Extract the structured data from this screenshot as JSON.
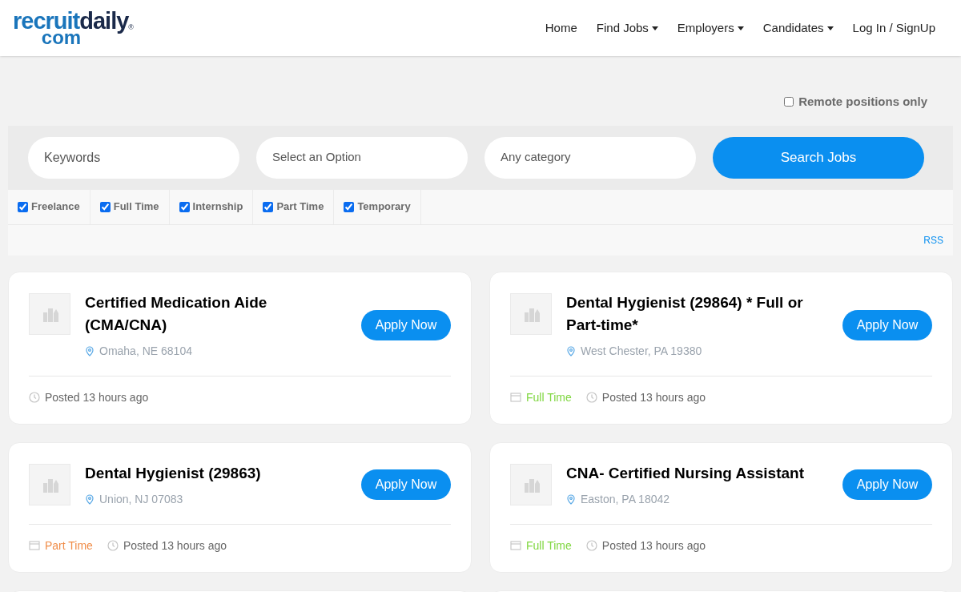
{
  "logo": {
    "part_1": "recruit",
    "part_2": "daily",
    "part_3": "com",
    "mark": "®"
  },
  "nav": [
    {
      "label": "Home",
      "dropdown": false
    },
    {
      "label": "Find Jobs",
      "dropdown": true
    },
    {
      "label": "Employers",
      "dropdown": true
    },
    {
      "label": "Candidates",
      "dropdown": true
    },
    {
      "label": "Log In / SignUp",
      "dropdown": false
    }
  ],
  "remote_only": {
    "label": "Remote positions only",
    "checked": false
  },
  "search": {
    "keywords": {
      "placeholder": "Keywords"
    },
    "location": {
      "placeholder": "Select an Option"
    },
    "category": {
      "placeholder": "Any category"
    },
    "button": "Search Jobs"
  },
  "job_types": [
    {
      "label": "Freelance",
      "checked": true
    },
    {
      "label": "Full Time",
      "checked": true
    },
    {
      "label": "Internship",
      "checked": true
    },
    {
      "label": "Part Time",
      "checked": true
    },
    {
      "label": "Temporary",
      "checked": true
    }
  ],
  "rss": "RSS",
  "jobs": [
    {
      "title": "Certified Medication Aide (CMA/CNA)",
      "location": "Omaha, NE 68104",
      "button": "Apply Now",
      "posted": "Posted 13 hours ago"
    },
    {
      "title": "Dental Hygienist (29864) * Full or Part-time*",
      "location": "West Chester, PA 19380",
      "button": "Apply Now",
      "job_type": {
        "label": "Full Time",
        "color": "#81d742"
      },
      "posted": "Posted 13 hours ago"
    },
    {
      "title": "Dental Hygienist (29863)",
      "location": "Union, NJ 07083",
      "button": "Apply Now",
      "job_type": {
        "label": "Part Time",
        "color": "#f08d49"
      },
      "posted": "Posted 13 hours ago"
    },
    {
      "title": "CNA- Certified Nursing Assistant",
      "location": "Easton, PA 18042",
      "button": "Apply Now",
      "job_type": {
        "label": "Full Time",
        "color": "#81d742"
      },
      "posted": "Posted 13 hours ago"
    }
  ]
}
